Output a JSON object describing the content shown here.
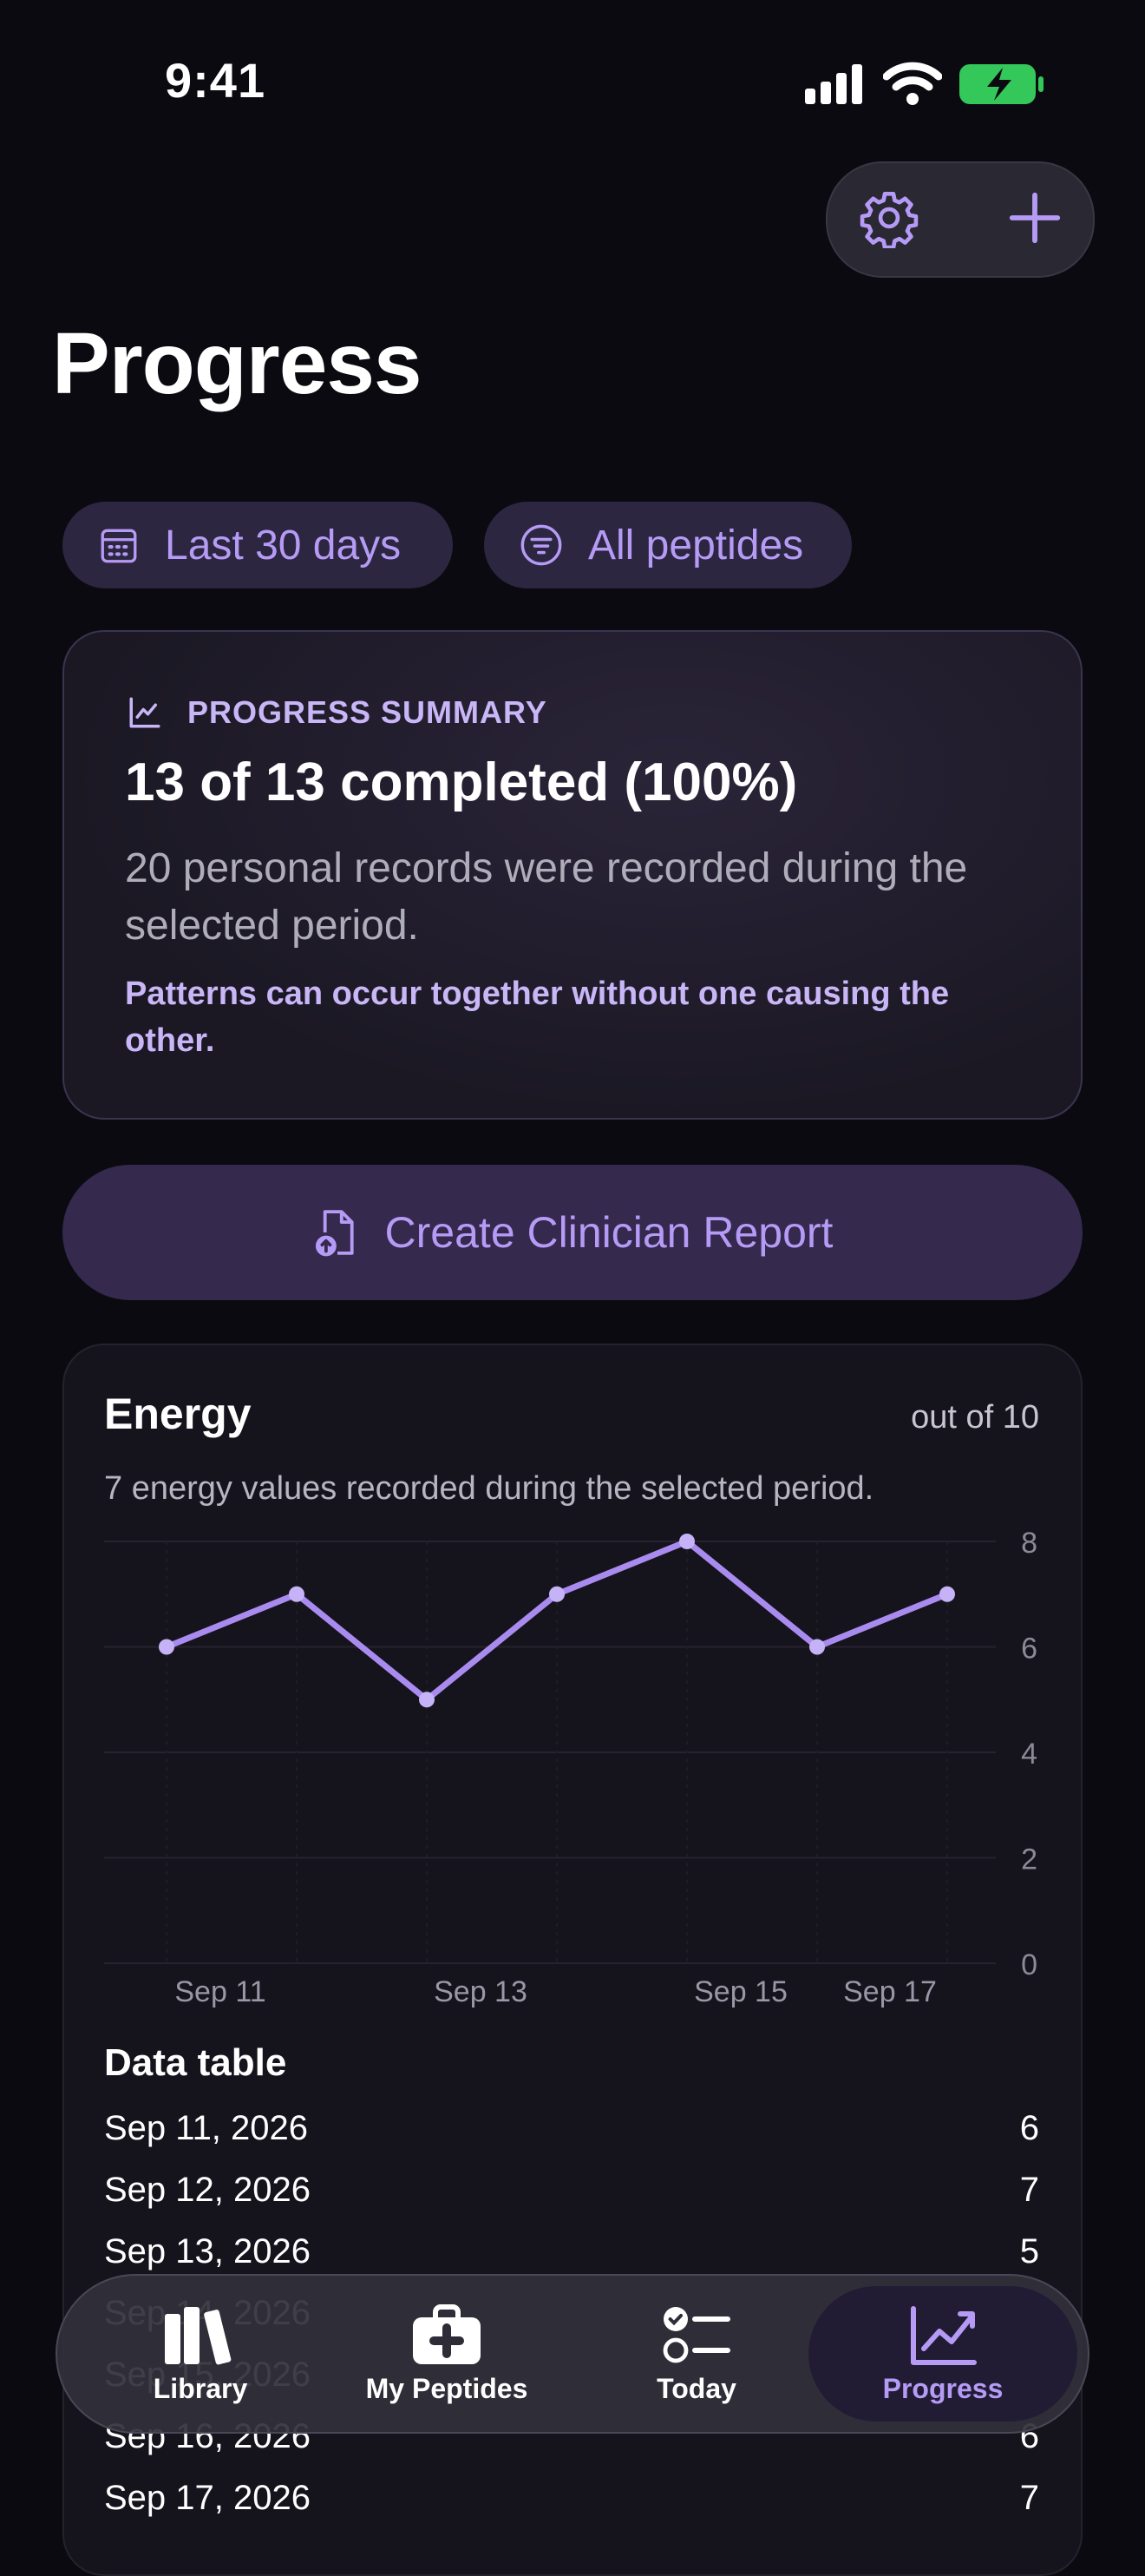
{
  "status_bar": {
    "time": "9:41"
  },
  "header": {
    "title": "Progress"
  },
  "filters": {
    "date_range": "Last 30 days",
    "peptide_filter": "All peptides"
  },
  "summary": {
    "label": "PROGRESS SUMMARY",
    "headline": "13 of 13 completed (100%)",
    "body": "20 personal records were recorded during the selected period.",
    "note": "Patterns can occur together without one causing the other."
  },
  "report_button": {
    "label": "Create Clinician Report"
  },
  "energy": {
    "title": "Energy",
    "unit": "out of 10",
    "description": "7 energy values recorded during the selected period."
  },
  "chart_data": {
    "type": "line",
    "x": [
      "Sep 11",
      "Sep 12",
      "Sep 13",
      "Sep 14",
      "Sep 15",
      "Sep 16",
      "Sep 17"
    ],
    "y": [
      6,
      7,
      5,
      7,
      8,
      6,
      7
    ],
    "x_tick_labels": [
      "Sep 11",
      "Sep 13",
      "Sep 15",
      "Sep 17"
    ],
    "y_tick_labels": [
      "0",
      "2",
      "4",
      "6",
      "8"
    ],
    "ylim": [
      0,
      8
    ],
    "grid": true,
    "line_color": "#a98bf0"
  },
  "data_table": {
    "title": "Data table",
    "rows": [
      {
        "date": "Sep 11, 2026",
        "value": "6"
      },
      {
        "date": "Sep 12, 2026",
        "value": "7"
      },
      {
        "date": "Sep 13, 2026",
        "value": "5"
      },
      {
        "date": "Sep 14, 2026",
        "value": "7"
      },
      {
        "date": "Sep 15, 2026",
        "value": "8"
      },
      {
        "date": "Sep 16, 2026",
        "value": "6"
      },
      {
        "date": "Sep 17, 2026",
        "value": "7"
      }
    ]
  },
  "tabs": [
    {
      "label": "Library",
      "icon": "books-icon"
    },
    {
      "label": "My Peptides",
      "icon": "medkit-icon"
    },
    {
      "label": "Today",
      "icon": "checklist-icon"
    },
    {
      "label": "Progress",
      "icon": "chart-line-icon",
      "active": true
    }
  ],
  "colors": {
    "accent": "#b59bf5",
    "background": "#0b0a10",
    "card": "#15131c"
  }
}
